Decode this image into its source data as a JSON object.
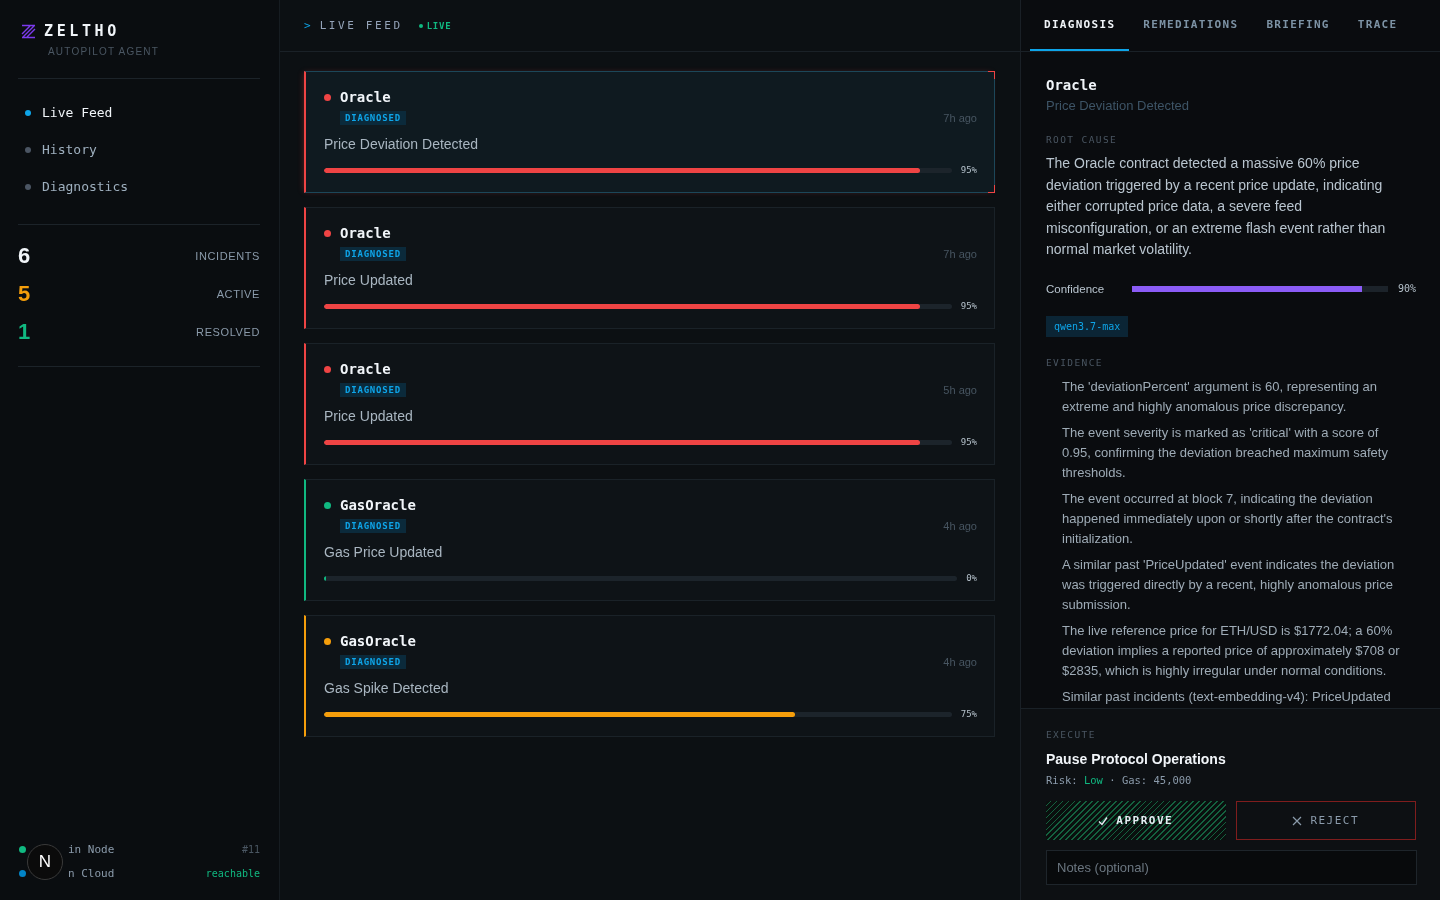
{
  "sidebar": {
    "brand": "ZELTHO",
    "tagline": "AUTOPILOT AGENT",
    "nav": [
      {
        "label": "Live Feed",
        "selected": true
      },
      {
        "label": "History",
        "selected": false
      },
      {
        "label": "Diagnostics",
        "selected": false
      }
    ],
    "stats": [
      {
        "value": "6",
        "label": "INCIDENTS",
        "color": "#f1f5f9"
      },
      {
        "value": "5",
        "label": "ACTIVE",
        "color": "#f59e0b"
      },
      {
        "value": "1",
        "label": "RESOLVED",
        "color": "#10b981"
      }
    ],
    "nodes": [
      {
        "name": "in Node",
        "status": "#11",
        "color": "#10b981",
        "kind": "counter"
      },
      {
        "name": "n Cloud",
        "status": "reachable",
        "color": "#0284c7",
        "kind": "health"
      }
    ]
  },
  "feed": {
    "prompt": ">",
    "title": "LIVE FEED",
    "live_label": "LIVE",
    "incidents": [
      {
        "name": "Oracle",
        "badge": "DIAGNOSED",
        "time": "7h ago",
        "title": "Price Deviation Detected",
        "level": 0.95,
        "reading": "95%",
        "color": "#ef4444",
        "selected": true
      },
      {
        "name": "Oracle",
        "badge": "DIAGNOSED",
        "time": "7h ago",
        "title": "Price Updated",
        "level": 0.95,
        "reading": "95%",
        "color": "#ef4444",
        "selected": false
      },
      {
        "name": "Oracle",
        "badge": "DIAGNOSED",
        "time": "5h ago",
        "title": "Price Updated",
        "level": 0.95,
        "reading": "95%",
        "color": "#ef4444",
        "selected": false
      },
      {
        "name": "GasOracle",
        "badge": "DIAGNOSED",
        "time": "4h ago",
        "title": "Gas Price Updated",
        "level": 0,
        "reading": "0%",
        "color": "#10b981",
        "selected": false
      },
      {
        "name": "GasOracle",
        "badge": "DIAGNOSED",
        "time": "4h ago",
        "title": "Gas Spike Detected",
        "level": 0.75,
        "reading": "75%",
        "color": "#f59e0b",
        "selected": false
      }
    ]
  },
  "detail": {
    "tabs": [
      {
        "label": "DIAGNOSIS",
        "selected": true
      },
      {
        "label": "REMEDIATIONS",
        "selected": false
      },
      {
        "label": "BRIEFING",
        "selected": false
      },
      {
        "label": "TRACE",
        "selected": false
      }
    ],
    "name": "Oracle",
    "subtitle": "Price Deviation Detected",
    "root_cause_label": "ROOT CAUSE",
    "root_cause": "The Oracle contract detected a massive 60% price deviation triggered by a recent price update, indicating either corrupted price data, a severe feed misconfiguration, or an extreme flash event rather than normal market volatility.",
    "confidence": {
      "label": "Confidence",
      "level": 0.9,
      "reading": "90%"
    },
    "model": "qwen3.7-max",
    "evidence_label": "EVIDENCE",
    "evidence": [
      "The 'deviationPercent' argument is 60, representing an extreme and highly anomalous price discrepancy.",
      "The event severity is marked as 'critical' with a score of 0.95, confirming the deviation breached maximum safety thresholds.",
      "The event occurred at block 7, indicating the deviation happened immediately upon or shortly after the contract's initialization.",
      "A similar past 'PriceUpdated' event indicates the deviation was triggered directly by a recent, highly anomalous price submission.",
      "The live reference price for ETH/USD is $1772.04; a 60% deviation implies a reported price of approximately $708 or $2835, which is highly irregular under normal conditions.",
      "Similar past incidents (text-embedding-v4): PriceUpdated"
    ]
  },
  "execute": {
    "label": "EXECUTE",
    "title": "Pause Protocol Operations",
    "risk_label": "Risk:",
    "risk": "Low",
    "separator": "·",
    "gas_label": "Gas:",
    "gas": "45,000",
    "approve": "APPROVE",
    "reject": "REJECT",
    "notes_placeholder": "Notes (optional)"
  },
  "overlay": {
    "badge": "N"
  }
}
